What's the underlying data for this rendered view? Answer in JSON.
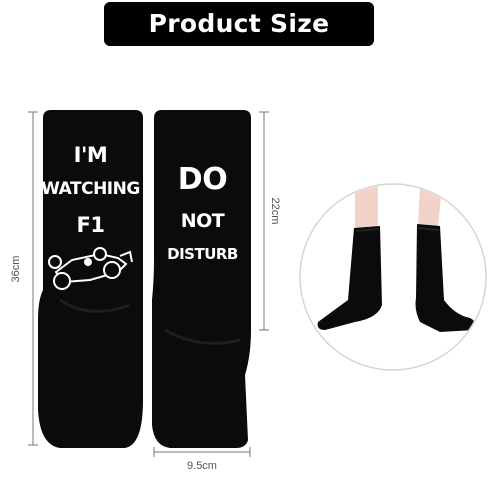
{
  "banner": {
    "title": "Product Size"
  },
  "dimensions": {
    "height_full": "36cm",
    "height_leg": "22cm",
    "width": "9.5cm"
  },
  "sock_left": {
    "line1": "I'M",
    "line2": "WATCHING",
    "line3": "F1",
    "graphic": "race-car-icon"
  },
  "sock_right": {
    "line1": "DO",
    "line2": "NOT",
    "line3": "DISTURB"
  },
  "colors": {
    "banner_bg": "#000000",
    "sock": "#0b0b0b",
    "text": "#ffffff",
    "skin": "#f2d3c9"
  }
}
